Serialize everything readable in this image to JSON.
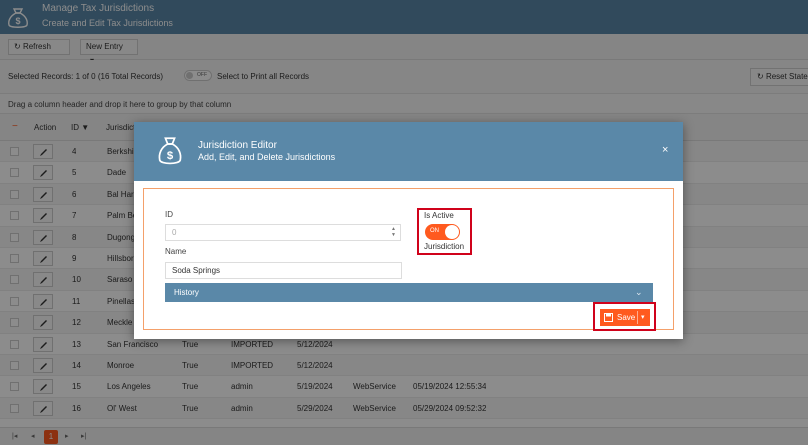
{
  "app": {
    "title": "Manage Tax Jurisdictions",
    "subtitle": "Create and Edit Tax Jurisdictions"
  },
  "toolbar": {
    "refresh_label": "Refresh",
    "new_entry_label": "New Entry"
  },
  "selection": {
    "text": "Selected Records: 1 of 0 (16 Total Records)",
    "toggle_label": "OFF",
    "print_all_label": "Select to Print all Records",
    "reset_label": "Reset State"
  },
  "group_hint": "Drag a column header and drop it here to group by that column",
  "grid": {
    "columns": {
      "action": "Action",
      "id": "ID",
      "jurisdiction": "Jurisdicti"
    },
    "rows": [
      {
        "id": "4",
        "name": "Berkshi"
      },
      {
        "id": "5",
        "name": "Dade"
      },
      {
        "id": "6",
        "name": "Bal Har"
      },
      {
        "id": "7",
        "name": "Palm Be"
      },
      {
        "id": "8",
        "name": "Dugong"
      },
      {
        "id": "9",
        "name": "Hillsbor"
      },
      {
        "id": "10",
        "name": "Saraso"
      },
      {
        "id": "11",
        "name": "Pinellas"
      },
      {
        "id": "12",
        "name": "Meckle"
      },
      {
        "id": "13",
        "name": "San Francisco",
        "active": "True",
        "created_by": "IMPORTED",
        "date": "5/12/2024",
        "source": "",
        "modified": ""
      },
      {
        "id": "14",
        "name": "Monroe",
        "active": "True",
        "created_by": "IMPORTED",
        "date": "5/12/2024",
        "source": "",
        "modified": ""
      },
      {
        "id": "15",
        "name": "Los Angeles",
        "active": "True",
        "created_by": "admin",
        "date": "5/19/2024",
        "source": "WebService",
        "modified": "05/19/2024 12:55:34"
      },
      {
        "id": "16",
        "name": "Ol' West",
        "active": "True",
        "created_by": "admin",
        "date": "5/29/2024",
        "source": "WebService",
        "modified": "05/29/2024 09:52:32"
      }
    ]
  },
  "pager": {
    "current_page": "1"
  },
  "modal": {
    "title": "Jurisdiction Editor",
    "subtitle": "Add, Edit, and Delete Jurisdictions",
    "id_label": "ID",
    "id_placeholder": "0",
    "name_label": "Name",
    "name_value": "Soda Springs",
    "is_active_label": "Is Active",
    "toggle_on_label": "ON",
    "toggle_sub_label": "Jurisdiction",
    "history_label": "History",
    "save_label": "Save"
  },
  "colors": {
    "header_bg": "#5a88a8",
    "accent": "#ff5a1f",
    "highlight_border": "#d0021b",
    "form_border": "#f4a06a"
  }
}
